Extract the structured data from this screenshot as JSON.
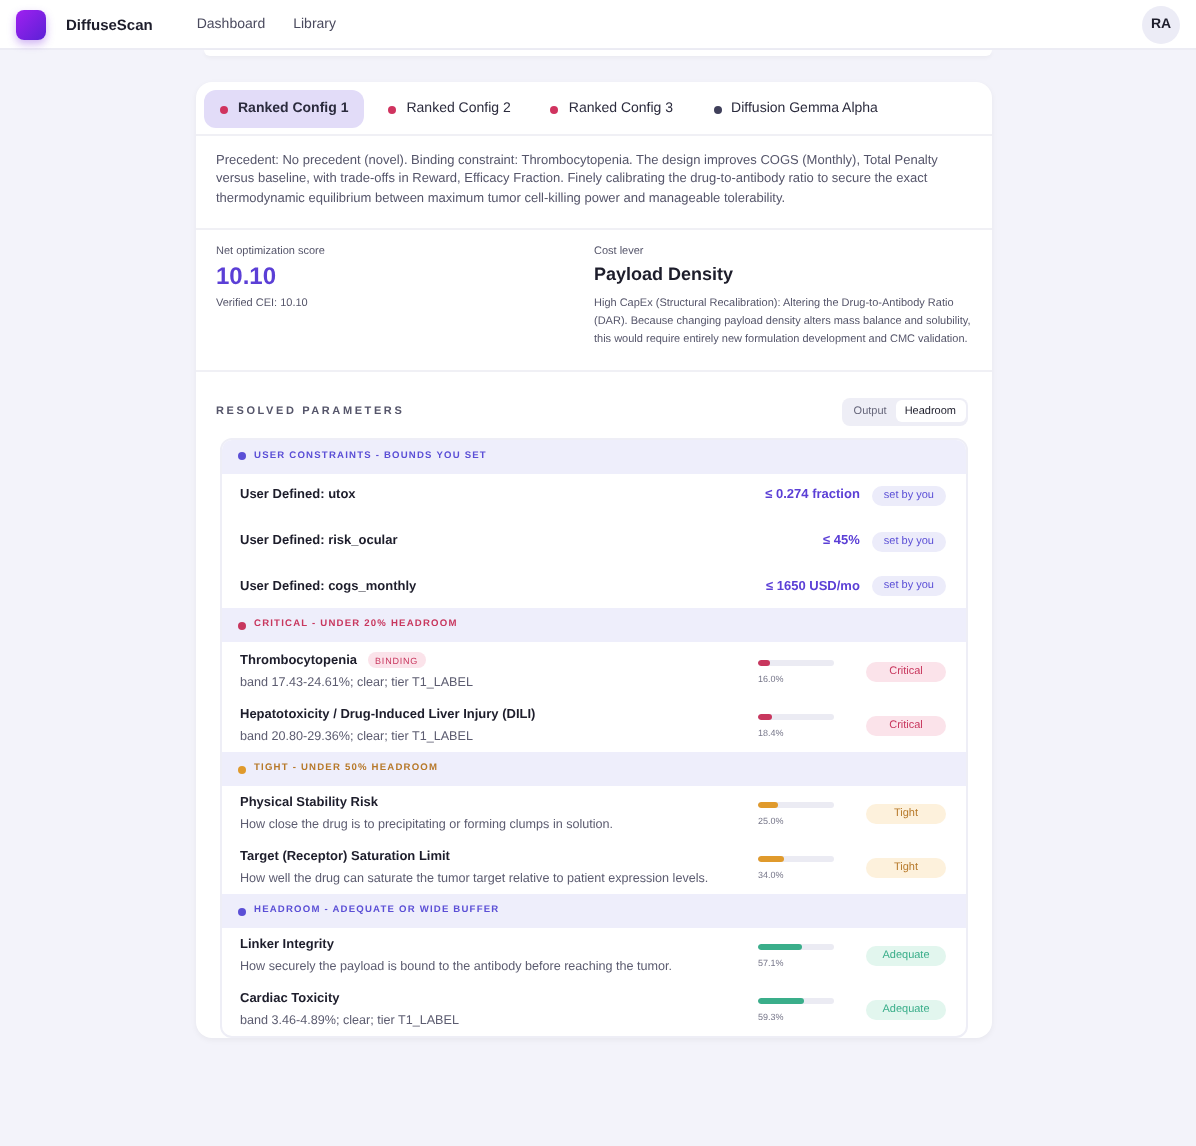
{
  "nav": {
    "brand": "DiffuseScan",
    "links": [
      {
        "label": "Dashboard"
      },
      {
        "label": "Library"
      }
    ],
    "avatar": "RA"
  },
  "tabs": [
    {
      "label": "Ranked Config 1",
      "selected": true,
      "color": "#d0335f"
    },
    {
      "label": "Ranked Config 2",
      "selected": false,
      "color": "#d0335f"
    },
    {
      "label": "Ranked Config 3",
      "selected": false,
      "color": "#d0335f"
    },
    {
      "label": "Diffusion Gemma Alpha",
      "selected": false,
      "color": "#3f3f5a"
    }
  ],
  "summary": "Precedent: No precedent (novel). Binding constraint: Thrombocytopenia. The design improves COGS (Monthly), Total Penalty versus baseline, with trade-offs in Reward, Efficacy Fraction. Finely calibrating the drug-to-antibody ratio to secure the exact thermodynamic equilibrium between maximum tumor cell-killing power and manageable tolerability.",
  "score": {
    "label": "Net optimization score",
    "value": "10.10",
    "verified": "Verified CEI: 10.10"
  },
  "lever": {
    "label": "Cost lever",
    "title": "Payload Density",
    "text": "High CapEx (Structural Recalibration): Altering the Drug-to-Antibody Ratio (DAR). Because changing payload density alters mass balance and solubility, this would require entirely new formulation development and CMC validation."
  },
  "parameters": {
    "title": "RESOLVED PARAMETERS",
    "view_toggle": [
      {
        "label": "Output",
        "selected": false
      },
      {
        "label": "Headroom",
        "selected": true
      }
    ],
    "groups": [
      {
        "kind": "user",
        "title": "USER CONSTRAINTS - BOUNDS YOU SET",
        "rows": [
          {
            "name": "User Defined: utox",
            "value": "≤ 0.274 fraction",
            "badge": "set by you"
          },
          {
            "name": "User Defined: risk_ocular",
            "value": "≤ 45%",
            "badge": "set by you"
          },
          {
            "name": "User Defined: cogs_monthly",
            "value": "≤ 1650 USD/mo",
            "badge": "set by you"
          }
        ]
      },
      {
        "kind": "critical",
        "title": "CRITICAL - UNDER 20% HEADROOM",
        "rows": [
          {
            "name": "Thrombocytopenia",
            "tag": "BINDING",
            "detail": "band 17.43-24.61%; clear; tier T1_LABEL",
            "level": 0.16,
            "reading": "16.0%",
            "badge": "Critical"
          },
          {
            "name": "Hepatotoxicity / Drug-Induced Liver Injury (DILI)",
            "detail": "band 20.80-29.36%; clear; tier T1_LABEL",
            "level": 0.184,
            "reading": "18.4%",
            "badge": "Critical"
          }
        ]
      },
      {
        "kind": "tight",
        "title": "TIGHT - UNDER 50% HEADROOM",
        "rows": [
          {
            "name": "Physical Stability Risk",
            "detail": "How close the drug is to precipitating or forming clumps in solution.",
            "level": 0.25,
            "reading": "25.0%",
            "badge": "Tight"
          },
          {
            "name": "Target (Receptor) Saturation Limit",
            "detail": "How well the drug can saturate the tumor target relative to patient expression levels.",
            "level": 0.34,
            "reading": "34.0%",
            "badge": "Tight"
          }
        ]
      },
      {
        "kind": "headroom",
        "title": "HEADROOM - ADEQUATE OR WIDE BUFFER",
        "rows": [
          {
            "name": "Linker Integrity",
            "detail": "How securely the payload is bound to the antibody before reaching the tumor.",
            "level": 0.571,
            "reading": "57.1%",
            "badge": "Adequate"
          },
          {
            "name": "Cardiac Toxicity",
            "detail": "band 3.46-4.89%; clear; tier T1_LABEL",
            "level": 0.593,
            "reading": "59.3%",
            "badge": "Adequate"
          }
        ]
      }
    ]
  }
}
